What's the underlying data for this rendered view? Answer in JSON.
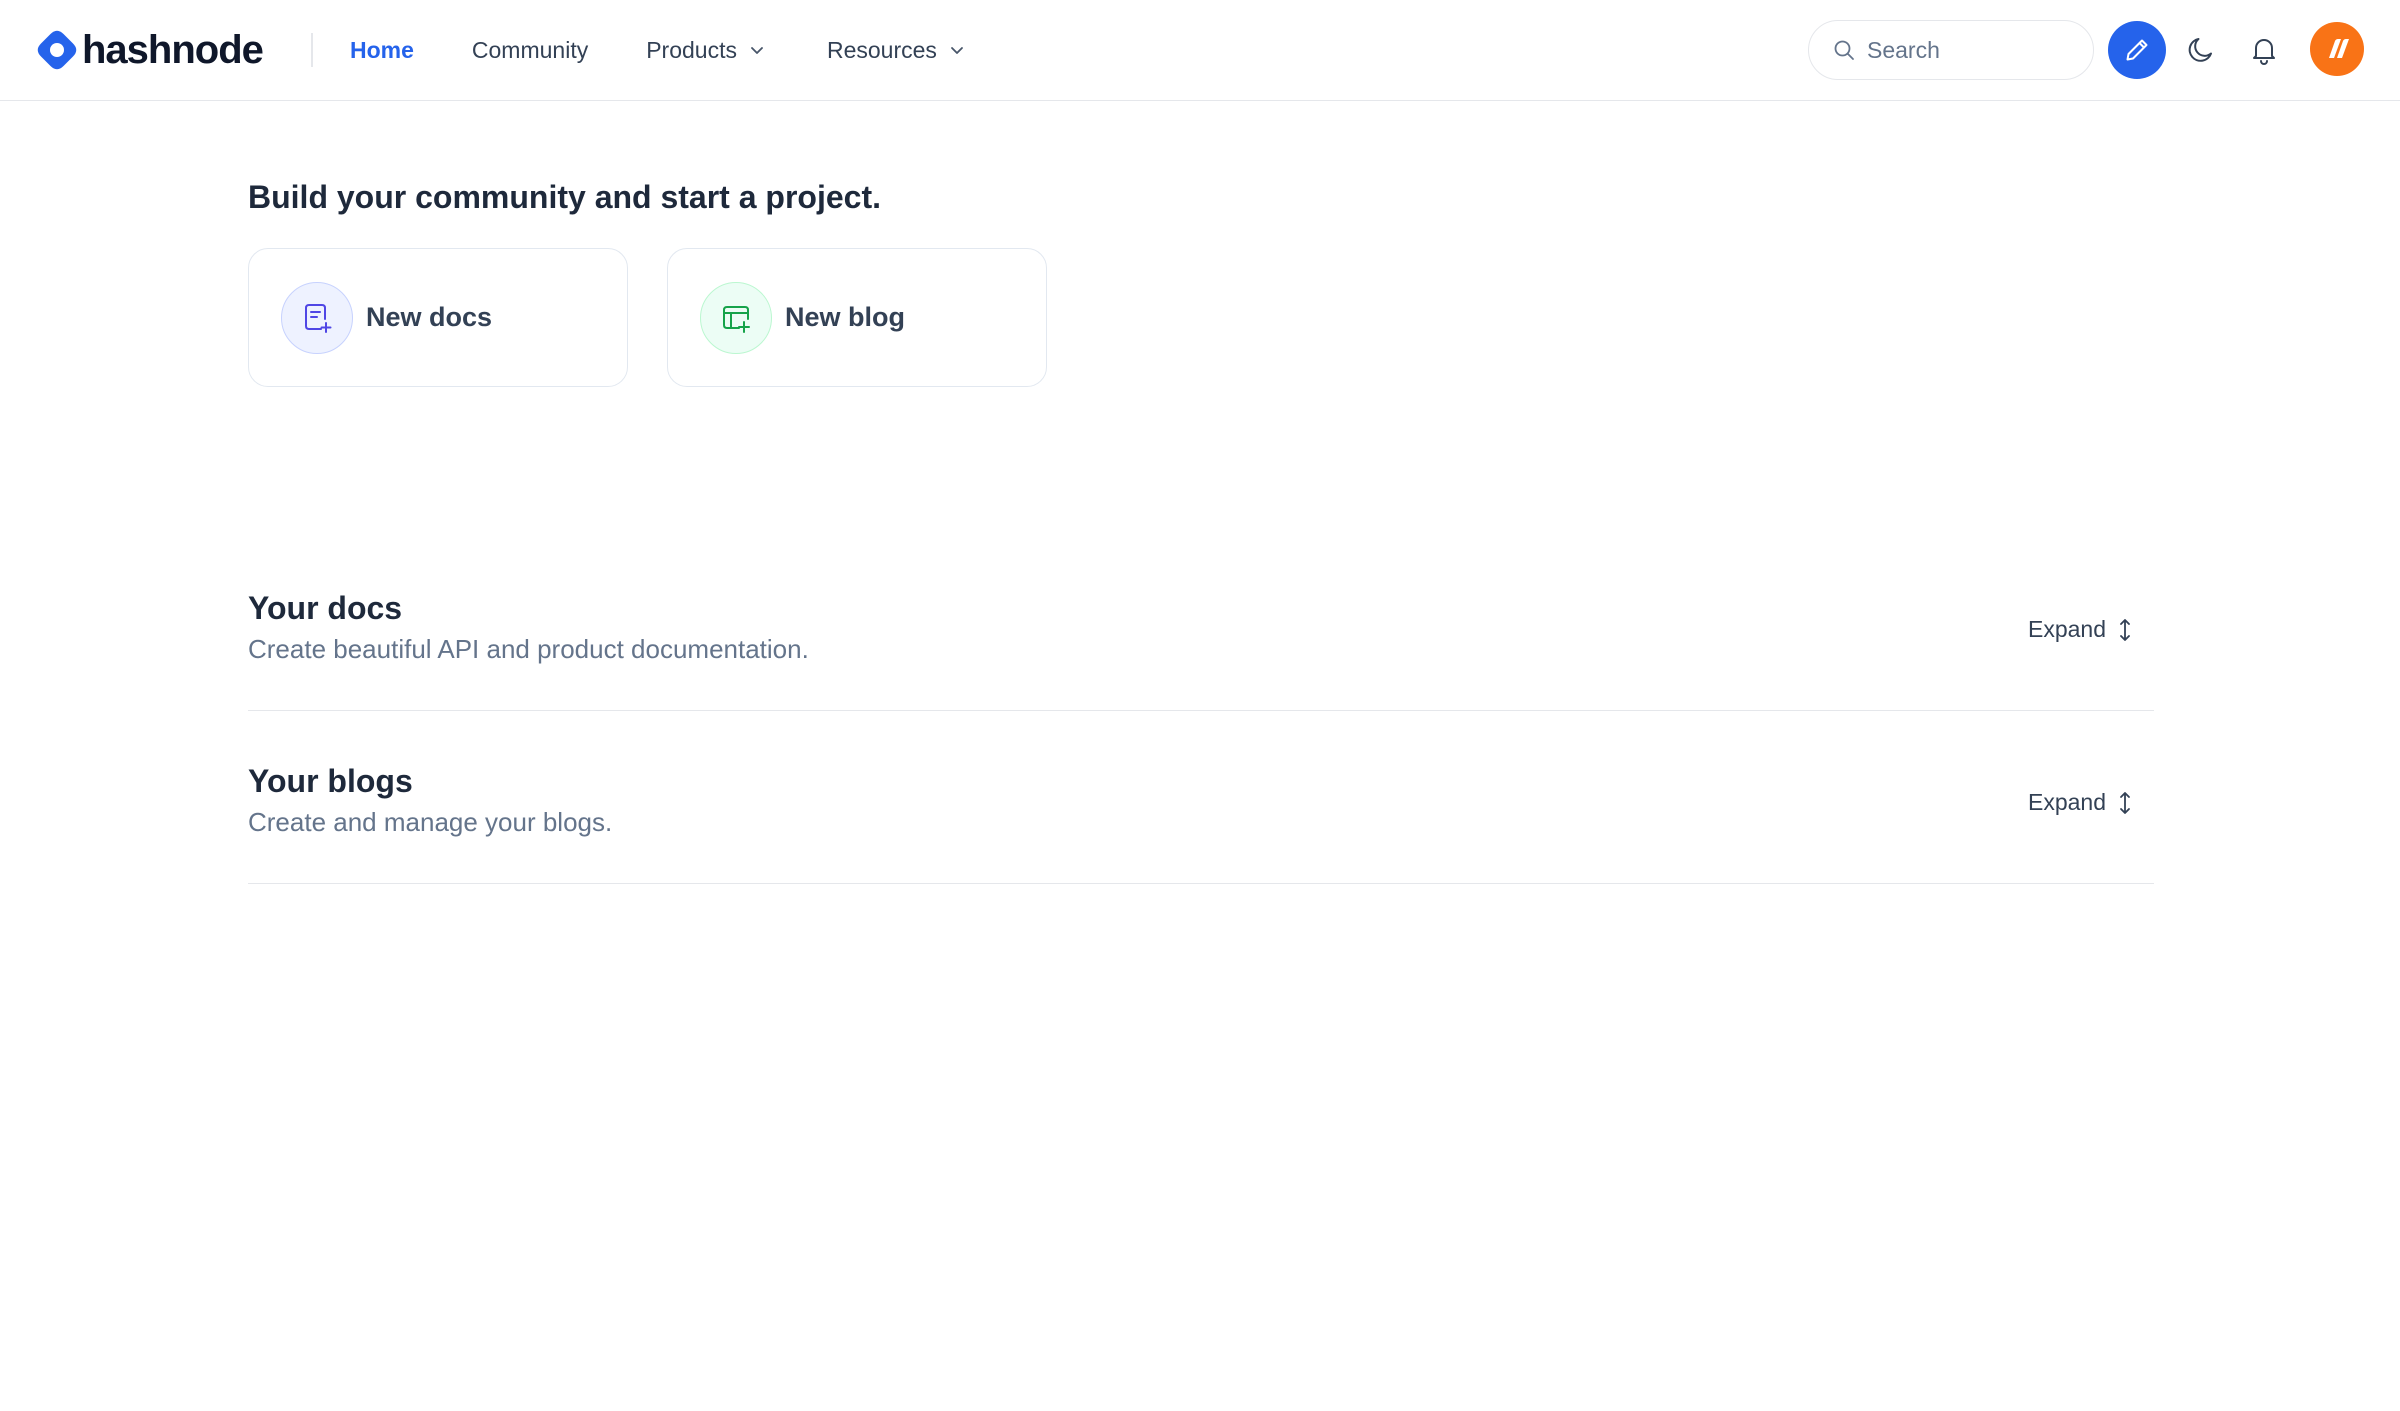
{
  "brand": {
    "name": "hashnode",
    "accent": "#2563eb"
  },
  "nav": {
    "items": [
      {
        "label": "Home",
        "active": true
      },
      {
        "label": "Community",
        "active": false
      },
      {
        "label": "Products",
        "active": false,
        "dropdown": true
      },
      {
        "label": "Resources",
        "active": false,
        "dropdown": true
      }
    ]
  },
  "search": {
    "placeholder": "Search"
  },
  "header_icons": [
    "pencil-icon",
    "moon-icon",
    "bell-icon",
    "user-avatar"
  ],
  "main": {
    "hero_title": "Build your community and start a project.",
    "cards": [
      {
        "label": "New docs",
        "icon": "docs-plus-icon",
        "color": "#4f46e5"
      },
      {
        "label": "New blog",
        "icon": "blog-plus-icon",
        "color": "#16a34a"
      }
    ],
    "sections": [
      {
        "title": "Your docs",
        "subtitle": "Create beautiful API and product documentation.",
        "action": "Expand"
      },
      {
        "title": "Your blogs",
        "subtitle": "Create and manage your blogs.",
        "action": "Expand"
      }
    ]
  }
}
